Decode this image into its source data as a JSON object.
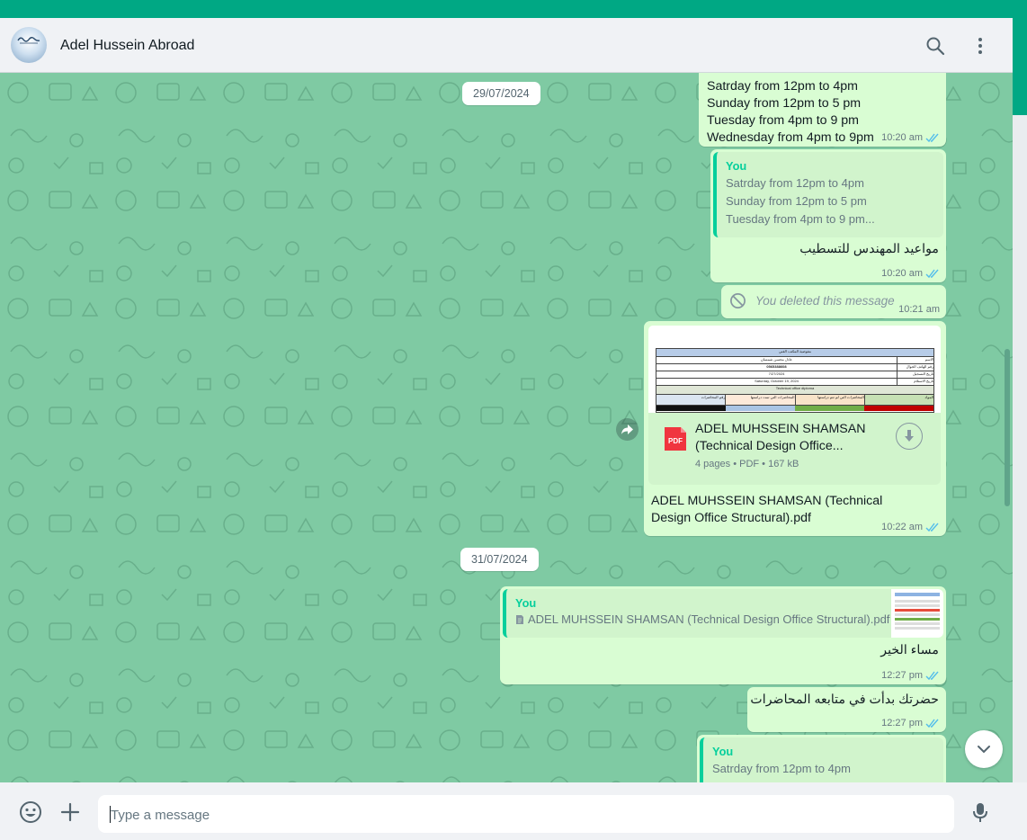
{
  "contact": {
    "name": "Adel Hussein Abroad"
  },
  "icons": {
    "search": "search-icon",
    "menu": "kebab-menu-icon",
    "emoji": "emoji-icon",
    "attach": "plus-icon",
    "mic": "microphone-icon",
    "forward": "forward-icon",
    "download": "download-icon",
    "scroll_down": "chevron-down-icon"
  },
  "colors": {
    "accent": "#00a884",
    "bubble_out": "#d9fdd3",
    "chat_bg": "#7fcaa3",
    "tick_read": "#53bdeb"
  },
  "dates": [
    "29/07/2024",
    "31/07/2024"
  ],
  "messages": {
    "schedule_top": {
      "lines": [
        "Satrday from 12pm to 4pm",
        "Sunday from 12pm to 5 pm",
        "Tuesday from 4pm to 9 pm",
        "Wednesday from 4pm to 9pm"
      ],
      "time": "10:20 am"
    },
    "reply_appointments": {
      "quote_author": "You",
      "quote_lines": [
        "Satrday from 12pm to 4pm",
        "Sunday from 12pm to 5 pm",
        "Tuesday from 4pm to 9 pm..."
      ],
      "text": "مواعيد المهندس للتسطيب",
      "time": "10:20 am"
    },
    "deleted": {
      "text": "You deleted this message",
      "time": "10:21 am"
    },
    "document": {
      "title_line1": "ADEL MUHSSEIN SHAMSAN",
      "title_line2": "(Technical Design Office...",
      "meta": "4 pages • PDF • 167 kB",
      "badge": "PDF",
      "caption": "ADEL MUHSSEIN SHAMSAN (Technical Design Office Structural).pdf",
      "time": "10:22 am",
      "preview_labels": {
        "title": "مفوضية المكتب الفني",
        "row1": "الاسم",
        "row1_val": "عادل محسن شمسان",
        "row2": "رقم الهاتف الجوال",
        "row2_val": "0565388608",
        "row3": "تاريخ التسجيل",
        "row3_val": "7/27/2024",
        "row4": "تاريخ الاستلام",
        "row4_val": "Saturday, October 19, 2024",
        "section": "Technical office diploma",
        "col1": "رقم المحاضرات",
        "col2": "المحاضرات التي تمت دراستها",
        "col3": "المحاضرات التي لم تتم دراستها",
        "col4": "المواد"
      }
    },
    "reply_evening": {
      "quote_author": "You",
      "quote_text": "ADEL MUHSSEIN SHAMSAN (Technical Design Office Structural).pdf",
      "text": "مساء الخير",
      "time": "12:27 pm"
    },
    "started": {
      "text": "حضرتك بدأت في متابعه المحاضرات",
      "time": "12:27 pm"
    },
    "reply_partial": {
      "quote_author": "You",
      "quote_line": "Satrday from 12pm to 4pm"
    }
  },
  "composer": {
    "placeholder": "Type a message"
  }
}
